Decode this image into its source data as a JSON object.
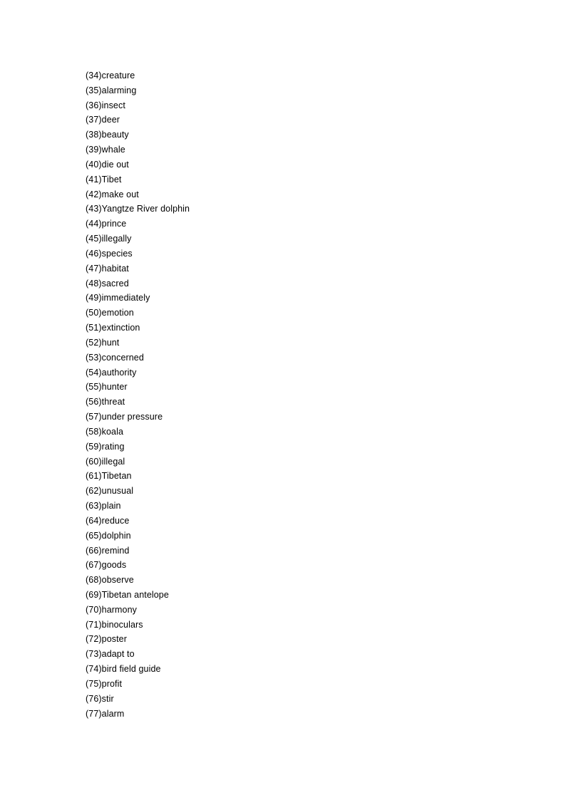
{
  "document": {
    "items": [
      {
        "number": "34",
        "word": "creature"
      },
      {
        "number": "35",
        "word": "alarming"
      },
      {
        "number": "36",
        "word": "insect"
      },
      {
        "number": "37",
        "word": "deer"
      },
      {
        "number": "38",
        "word": "beauty"
      },
      {
        "number": "39",
        "word": "whale"
      },
      {
        "number": "40",
        "word": "die out"
      },
      {
        "number": "41",
        "word": "Tibet"
      },
      {
        "number": "42",
        "word": "make out"
      },
      {
        "number": "43",
        "word": "Yangtze River dolphin"
      },
      {
        "number": "44",
        "word": "prince"
      },
      {
        "number": "45",
        "word": "illegally"
      },
      {
        "number": "46",
        "word": "species"
      },
      {
        "number": "47",
        "word": "habitat"
      },
      {
        "number": "48",
        "word": "sacred"
      },
      {
        "number": "49",
        "word": "immediately"
      },
      {
        "number": "50",
        "word": "emotion"
      },
      {
        "number": "51",
        "word": "extinction"
      },
      {
        "number": "52",
        "word": "hunt"
      },
      {
        "number": "53",
        "word": "concerned"
      },
      {
        "number": "54",
        "word": "authority"
      },
      {
        "number": "55",
        "word": "hunter"
      },
      {
        "number": "56",
        "word": "threat"
      },
      {
        "number": "57",
        "word": "under pressure"
      },
      {
        "number": "58",
        "word": "koala"
      },
      {
        "number": "59",
        "word": "rating"
      },
      {
        "number": "60",
        "word": "illegal"
      },
      {
        "number": "61",
        "word": "Tibetan"
      },
      {
        "number": "62",
        "word": "unusual"
      },
      {
        "number": "63",
        "word": "plain"
      },
      {
        "number": "64",
        "word": "reduce"
      },
      {
        "number": "65",
        "word": "dolphin"
      },
      {
        "number": "66",
        "word": "remind"
      },
      {
        "number": "67",
        "word": "goods"
      },
      {
        "number": "68",
        "word": "observe"
      },
      {
        "number": "69",
        "word": "Tibetan antelope"
      },
      {
        "number": "70",
        "word": "harmony"
      },
      {
        "number": "71",
        "word": "binoculars"
      },
      {
        "number": "72",
        "word": "poster"
      },
      {
        "number": "73",
        "word": "adapt to"
      },
      {
        "number": "74",
        "word": "bird field guide"
      },
      {
        "number": "75",
        "word": "profit"
      },
      {
        "number": "76",
        "word": "stir"
      },
      {
        "number": "77",
        "word": "alarm"
      }
    ]
  }
}
